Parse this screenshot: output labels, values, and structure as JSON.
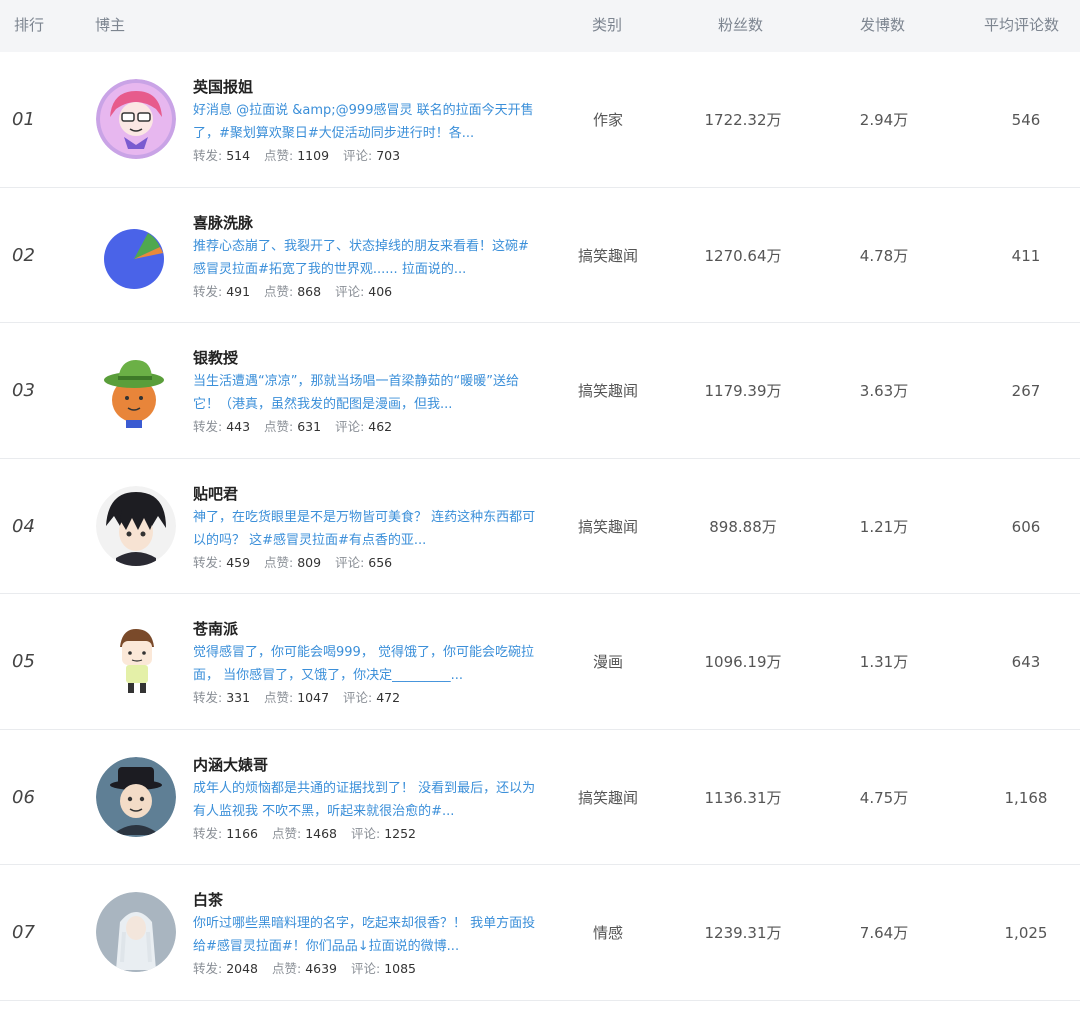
{
  "header": {
    "rank": "排行",
    "blogger": "博主",
    "category": "类别",
    "fans": "粉丝数",
    "posts": "发博数",
    "avg_comments": "平均评论数"
  },
  "stats_labels": {
    "repost": "转发: ",
    "likes": "点赞: ",
    "comments": "评论: "
  },
  "rows": [
    {
      "rank": "01",
      "name": "英国报姐",
      "desc": "好消息 @拉面说 &amp;@999感冒灵 联名的拉面今天开售了，#聚划算欢聚日#大促活动同步进行时！各...",
      "repost": "514",
      "likes": "1109",
      "comments": "703",
      "category": "作家",
      "fans": "1722.32万",
      "posts": "2.94万",
      "avg_comments": "546"
    },
    {
      "rank": "02",
      "name": "喜脉洗脉",
      "desc": "推荐心态崩了、我裂开了、状态掉线的朋友来看看！这碗#感冒灵拉面#拓宽了我的世界观...... 拉面说的...",
      "repost": "491",
      "likes": "868",
      "comments": "406",
      "category": "搞笑趣闻",
      "fans": "1270.64万",
      "posts": "4.78万",
      "avg_comments": "411"
    },
    {
      "rank": "03",
      "name": "银教授",
      "desc": "当生活遭遇“凉凉”，那就当场唱一首梁静茹的“暖暖”送给它！（港真，虽然我发的配图是漫画，但我...",
      "repost": "443",
      "likes": "631",
      "comments": "462",
      "category": "搞笑趣闻",
      "fans": "1179.39万",
      "posts": "3.63万",
      "avg_comments": "267"
    },
    {
      "rank": "04",
      "name": "贴吧君",
      "desc": "神了，在吃货眼里是不是万物皆可美食？ 连药这种东西都可以的吗？ 这#感冒灵拉面#有点香的亚...",
      "repost": "459",
      "likes": "809",
      "comments": "656",
      "category": "搞笑趣闻",
      "fans": "898.88万",
      "posts": "1.21万",
      "avg_comments": "606"
    },
    {
      "rank": "05",
      "name": "苍南派",
      "desc": "觉得感冒了，你可能会喝999， 觉得饿了，你可能会吃碗拉面， 当你感冒了，又饿了，你决定_________...",
      "repost": "331",
      "likes": "1047",
      "comments": "472",
      "category": "漫画",
      "fans": "1096.19万",
      "posts": "1.31万",
      "avg_comments": "643"
    },
    {
      "rank": "06",
      "name": "内涵大婊哥",
      "desc": "成年人的烦恼都是共通的证据找到了！ 没看到最后，还以为有人监视我 不吹不黑，听起来就很治愈的#...",
      "repost": "1166",
      "likes": "1468",
      "comments": "1252",
      "category": "搞笑趣闻",
      "fans": "1136.31万",
      "posts": "4.75万",
      "avg_comments": "1,168"
    },
    {
      "rank": "07",
      "name": "白茶",
      "desc": "你听过哪些黑暗料理的名字，吃起来却很香？！ 我单方面投给#感冒灵拉面#！你们品品↓拉面说的微博...",
      "repost": "2048",
      "likes": "4639",
      "comments": "1085",
      "category": "情感",
      "fans": "1239.31万",
      "posts": "7.64万",
      "avg_comments": "1,025"
    }
  ]
}
